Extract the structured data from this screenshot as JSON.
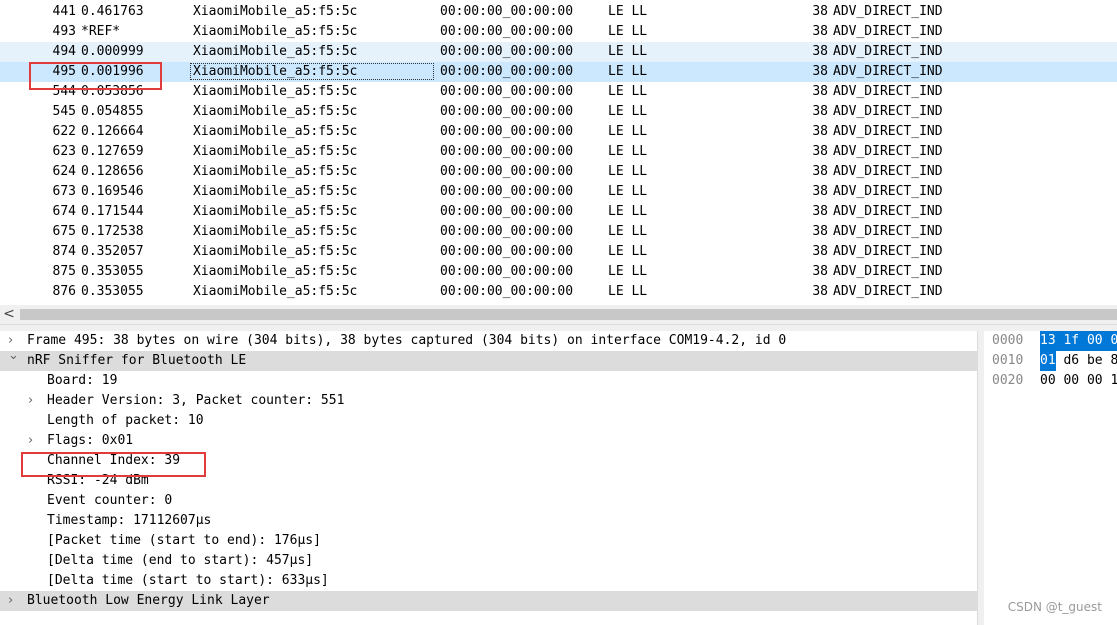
{
  "packets": [
    {
      "no": "441",
      "time": "0.461763",
      "source": "XiaomiMobile_a5:f5:5c",
      "destination": "00:00:00_00:00:00",
      "protocol": "LE LL",
      "length": "38",
      "info": "ADV_DIRECT_IND"
    },
    {
      "no": "493",
      "time": "*REF*",
      "source": "XiaomiMobile_a5:f5:5c",
      "destination": "00:00:00_00:00:00",
      "protocol": "LE LL",
      "length": "38",
      "info": "ADV_DIRECT_IND"
    },
    {
      "no": "494",
      "time": "0.000999",
      "source": "XiaomiMobile_a5:f5:5c",
      "destination": "00:00:00_00:00:00",
      "protocol": "LE LL",
      "length": "38",
      "info": "ADV_DIRECT_IND"
    },
    {
      "no": "495",
      "time": "0.001996",
      "source": "XiaomiMobile_a5:f5:5c",
      "destination": "00:00:00_00:00:00",
      "protocol": "LE LL",
      "length": "38",
      "info": "ADV_DIRECT_IND"
    },
    {
      "no": "544",
      "time": "0.053856",
      "source": "XiaomiMobile_a5:f5:5c",
      "destination": "00:00:00_00:00:00",
      "protocol": "LE LL",
      "length": "38",
      "info": "ADV_DIRECT_IND"
    },
    {
      "no": "545",
      "time": "0.054855",
      "source": "XiaomiMobile_a5:f5:5c",
      "destination": "00:00:00_00:00:00",
      "protocol": "LE LL",
      "length": "38",
      "info": "ADV_DIRECT_IND"
    },
    {
      "no": "622",
      "time": "0.126664",
      "source": "XiaomiMobile_a5:f5:5c",
      "destination": "00:00:00_00:00:00",
      "protocol": "LE LL",
      "length": "38",
      "info": "ADV_DIRECT_IND"
    },
    {
      "no": "623",
      "time": "0.127659",
      "source": "XiaomiMobile_a5:f5:5c",
      "destination": "00:00:00_00:00:00",
      "protocol": "LE LL",
      "length": "38",
      "info": "ADV_DIRECT_IND"
    },
    {
      "no": "624",
      "time": "0.128656",
      "source": "XiaomiMobile_a5:f5:5c",
      "destination": "00:00:00_00:00:00",
      "protocol": "LE LL",
      "length": "38",
      "info": "ADV_DIRECT_IND"
    },
    {
      "no": "673",
      "time": "0.169546",
      "source": "XiaomiMobile_a5:f5:5c",
      "destination": "00:00:00_00:00:00",
      "protocol": "LE LL",
      "length": "38",
      "info": "ADV_DIRECT_IND"
    },
    {
      "no": "674",
      "time": "0.171544",
      "source": "XiaomiMobile_a5:f5:5c",
      "destination": "00:00:00_00:00:00",
      "protocol": "LE LL",
      "length": "38",
      "info": "ADV_DIRECT_IND"
    },
    {
      "no": "675",
      "time": "0.172538",
      "source": "XiaomiMobile_a5:f5:5c",
      "destination": "00:00:00_00:00:00",
      "protocol": "LE LL",
      "length": "38",
      "info": "ADV_DIRECT_IND"
    },
    {
      "no": "874",
      "time": "0.352057",
      "source": "XiaomiMobile_a5:f5:5c",
      "destination": "00:00:00_00:00:00",
      "protocol": "LE LL",
      "length": "38",
      "info": "ADV_DIRECT_IND"
    },
    {
      "no": "875",
      "time": "0.353055",
      "source": "XiaomiMobile_a5:f5:5c",
      "destination": "00:00:00_00:00:00",
      "protocol": "LE LL",
      "length": "38",
      "info": "ADV_DIRECT_IND"
    },
    {
      "no": "876",
      "time": "0.353055",
      "source": "XiaomiMobile_a5:f5:5c",
      "destination": "00:00:00_00:00:00",
      "protocol": "LE LL",
      "length": "38",
      "info": "ADV_DIRECT_IND"
    }
  ],
  "selected_packet_no": "495",
  "hovered_packet_no": "494",
  "scrollbar": {
    "left_arrow": "<"
  },
  "details": [
    {
      "level": 0,
      "expander": "collapsed",
      "text": "Frame 495: 38 bytes on wire (304 bits), 38 bytes captured (304 bits) on interface COM19-4.2, id 0"
    },
    {
      "level": 0,
      "expander": "expanded",
      "text": "nRF Sniffer for Bluetooth LE",
      "highlighted": true
    },
    {
      "level": 1,
      "expander": "none",
      "text": "Board: 19"
    },
    {
      "level": 1,
      "expander": "collapsed",
      "text": "Header Version: 3, Packet counter: 551"
    },
    {
      "level": 1,
      "expander": "none",
      "text": "Length of packet: 10"
    },
    {
      "level": 1,
      "expander": "collapsed",
      "text": "Flags: 0x01"
    },
    {
      "level": 1,
      "expander": "none",
      "text": "Channel Index: 39"
    },
    {
      "level": 1,
      "expander": "none",
      "text": "RSSI: -24 dBm"
    },
    {
      "level": 1,
      "expander": "none",
      "text": "Event counter: 0"
    },
    {
      "level": 1,
      "expander": "none",
      "text": "Timestamp: 17112607µs"
    },
    {
      "level": 1,
      "expander": "none",
      "text": "[Packet time (start to end): 176µs]"
    },
    {
      "level": 1,
      "expander": "none",
      "text": "[Delta time (end to start): 457µs]"
    },
    {
      "level": 1,
      "expander": "none",
      "text": "[Delta time (start to start): 633µs]"
    },
    {
      "level": 0,
      "expander": "collapsed",
      "text": "Bluetooth Low Energy Link Layer",
      "highlighted": true
    }
  ],
  "hex": [
    {
      "offset": "0000",
      "bytes": [
        {
          "b": "13",
          "sel": true
        },
        {
          "b": "1f",
          "sel": true
        },
        {
          "b": "00",
          "sel": true
        },
        {
          "b": "0",
          "sel": true
        }
      ]
    },
    {
      "offset": "0010",
      "bytes": [
        {
          "b": "01",
          "sel": true
        },
        {
          "b": "d6"
        },
        {
          "b": "be"
        },
        {
          "b": "8"
        }
      ]
    },
    {
      "offset": "0020",
      "bytes": [
        {
          "b": "00"
        },
        {
          "b": "00"
        },
        {
          "b": "00"
        },
        {
          "b": "1"
        }
      ]
    }
  ],
  "watermark": "CSDN @t_guest",
  "colors": {
    "selected_row": "#cce8ff",
    "hover_row": "#e5f1fb",
    "annotation": "#e03c3c",
    "hex_selection": "#0078d7"
  }
}
